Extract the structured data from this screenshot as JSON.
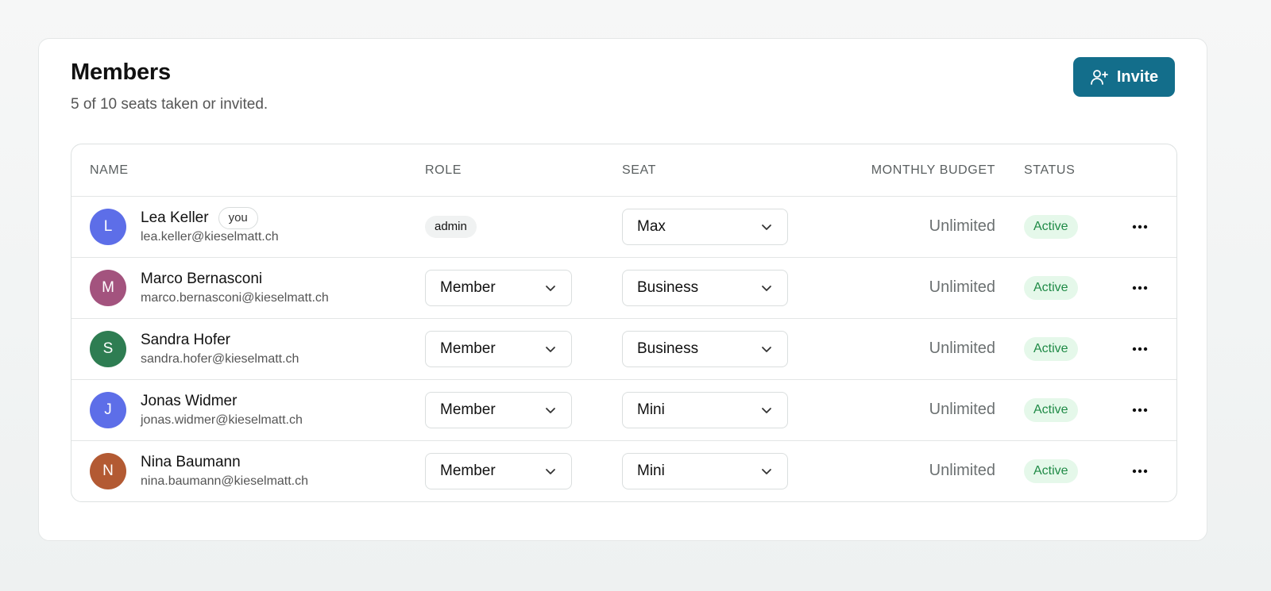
{
  "header": {
    "title": "Members",
    "subtitle": "5 of 10 seats taken or invited.",
    "invite_label": "Invite",
    "invite_icon": "user-plus-icon",
    "accent_color": "#136e8b"
  },
  "table": {
    "columns": {
      "name": "NAME",
      "role": "ROLE",
      "seat": "SEAT",
      "budget": "MONTHLY BUDGET",
      "status": "STATUS"
    },
    "rows": [
      {
        "initial": "L",
        "avatar_color": "#5d6ee8",
        "name": "Lea Keller",
        "you_label": "you",
        "email": "lea.keller@kieselmatt.ch",
        "role": "admin",
        "seat": "Max",
        "budget": "Unlimited",
        "status": "Active"
      },
      {
        "initial": "M",
        "avatar_color": "#a3537e",
        "name": "Marco Bernasconi",
        "email": "marco.bernasconi@kieselmatt.ch",
        "role": "Member",
        "seat": "Business",
        "budget": "Unlimited",
        "status": "Active"
      },
      {
        "initial": "S",
        "avatar_color": "#2e7d52",
        "name": "Sandra Hofer",
        "email": "sandra.hofer@kieselmatt.ch",
        "role": "Member",
        "seat": "Business",
        "budget": "Unlimited",
        "status": "Active"
      },
      {
        "initial": "J",
        "avatar_color": "#5d6ee8",
        "name": "Jonas Widmer",
        "email": "jonas.widmer@kieselmatt.ch",
        "role": "Member",
        "seat": "Mini",
        "budget": "Unlimited",
        "status": "Active"
      },
      {
        "initial": "N",
        "avatar_color": "#b35a33",
        "name": "Nina Baumann",
        "email": "nina.baumann@kieselmatt.ch",
        "role": "Member",
        "seat": "Mini",
        "budget": "Unlimited",
        "status": "Active"
      }
    ],
    "status_color": "#1f8a46",
    "chevron_icon": "chevron-down-icon",
    "more_icon": "more-options-icon"
  }
}
